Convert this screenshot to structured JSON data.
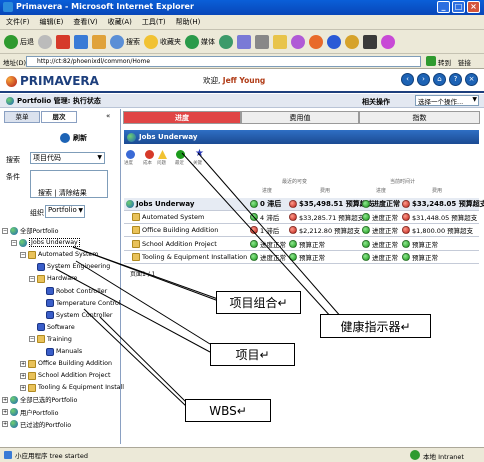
{
  "window": {
    "title": "Primavera - Microsoft Internet Explorer",
    "menu": [
      "文件(F)",
      "编辑(E)",
      "查看(V)",
      "收藏(A)",
      "工具(T)",
      "帮助(H)"
    ]
  },
  "toolbar": {
    "back_label": "后退",
    "search_label": "搜索",
    "favorites_label": "收藏夹",
    "media_label": "媒体"
  },
  "address": {
    "label": "地址(D)",
    "url": "http://ct:82/phoenixdl/common/Home",
    "go_label": "转到",
    "links_label": "链接"
  },
  "app": {
    "logo": "PRIMAVERA",
    "welcome_prefix": "欢迎,",
    "user": "Jeff Young",
    "subheader_title": "Portfolio 管理: 执行状态",
    "related_label": "相关操作",
    "related_select": "选择一个操作..."
  },
  "left": {
    "tabs": [
      "菜单",
      "层次"
    ],
    "refresh_label": "刷新",
    "search_label": "搜索",
    "search_value": "项目代码",
    "condition_label": "条件",
    "search_link": "搜索",
    "clear_link": "清除结果",
    "group_label": "组织",
    "group_value": "Portfolio",
    "tree": [
      {
        "label": "全部Portfolio",
        "level": 0,
        "icon": "globe-icon"
      },
      {
        "label": "Jobs Underway",
        "level": 1,
        "icon": "globe-icon"
      },
      {
        "label": "Automated System",
        "level": 2,
        "icon": "folder-icon"
      },
      {
        "label": "System Engineering",
        "level": 3,
        "icon": "wbs-icon"
      },
      {
        "label": "Hardware",
        "level": 3,
        "icon": "folder-icon"
      },
      {
        "label": "Robot Controller",
        "level": 4,
        "icon": "wbs-icon"
      },
      {
        "label": "Temperature Control",
        "level": 4,
        "icon": "wbs-icon"
      },
      {
        "label": "System Controller",
        "level": 4,
        "icon": "wbs-icon"
      },
      {
        "label": "Software",
        "level": 3,
        "icon": "wbs-icon"
      },
      {
        "label": "Training",
        "level": 3,
        "icon": "folder-icon"
      },
      {
        "label": "Manuals",
        "level": 4,
        "icon": "wbs-icon"
      },
      {
        "label": "Office Building Addition",
        "level": 2,
        "icon": "folder-icon"
      },
      {
        "label": "School Addition Project",
        "level": 2,
        "icon": "folder-icon"
      },
      {
        "label": "Tooling & Equipment Install",
        "level": 2,
        "icon": "folder-icon"
      },
      {
        "label": "全部已选的Portfolio",
        "level": 0,
        "icon": "globe-icon"
      },
      {
        "label": "用户Portfolio",
        "level": 0,
        "icon": "globe-icon"
      },
      {
        "label": "已过滤的Portfolio",
        "level": 0,
        "icon": "globe-icon"
      }
    ]
  },
  "right": {
    "tabs": [
      "进度",
      "费用值",
      "指数"
    ],
    "portlet_title": "Jobs Underway",
    "tool_icons": [
      "进度",
      "成本",
      "问题",
      "最近",
      "关键"
    ],
    "header_group1": "最近的可变",
    "header_group2": "当前时间计",
    "header_cols": [
      "进度",
      "费用",
      "进度",
      "费用"
    ],
    "rows": [
      {
        "name": "Jobs Underway",
        "s1": "0 滞后",
        "s1c": "g",
        "c1": "$35,498.51 预算超支",
        "c1c": "r",
        "s2": "进度正常",
        "s2c": "g",
        "c2": "$33,248.05 预算超支",
        "c2c": "r",
        "top": true
      },
      {
        "name": "Automated System",
        "s1": "4 滞后",
        "s1c": "g",
        "c1": "$33,285.71 预算超支",
        "c1c": "r",
        "s2": "进度正常",
        "s2c": "g",
        "c2": "$31,448.05 预算超支",
        "c2c": "r"
      },
      {
        "name": "Office Building Addition",
        "s1": "1 滞后",
        "s1c": "r",
        "c1": "$2,212.80 预算超支",
        "c1c": "r",
        "s2": "进度正常",
        "s2c": "g",
        "c2": "$1,800.00 预算超支",
        "c2c": "r"
      },
      {
        "name": "School Addition Project",
        "s1": "进度正常",
        "s1c": "g",
        "c1": "预算正常",
        "c1c": "g",
        "s2": "进度正常",
        "s2c": "g",
        "c2": "预算正常",
        "c2c": "g"
      },
      {
        "name": "Tooling & Equipment Installation",
        "s1": "进度正常",
        "s1c": "g",
        "c1": "预算正常",
        "c1c": "g",
        "s2": "进度正常",
        "s2c": "g",
        "c2": "预算正常",
        "c2c": "g"
      }
    ],
    "pager": "页面1 / 1"
  },
  "callouts": {
    "portfolio": "项目组合↵",
    "health": "健康指示器↵",
    "project": "项目↵",
    "wbs": "WBS↵"
  },
  "status": {
    "left": "小应用程序 tree started",
    "zone": "本地 Intranet"
  }
}
